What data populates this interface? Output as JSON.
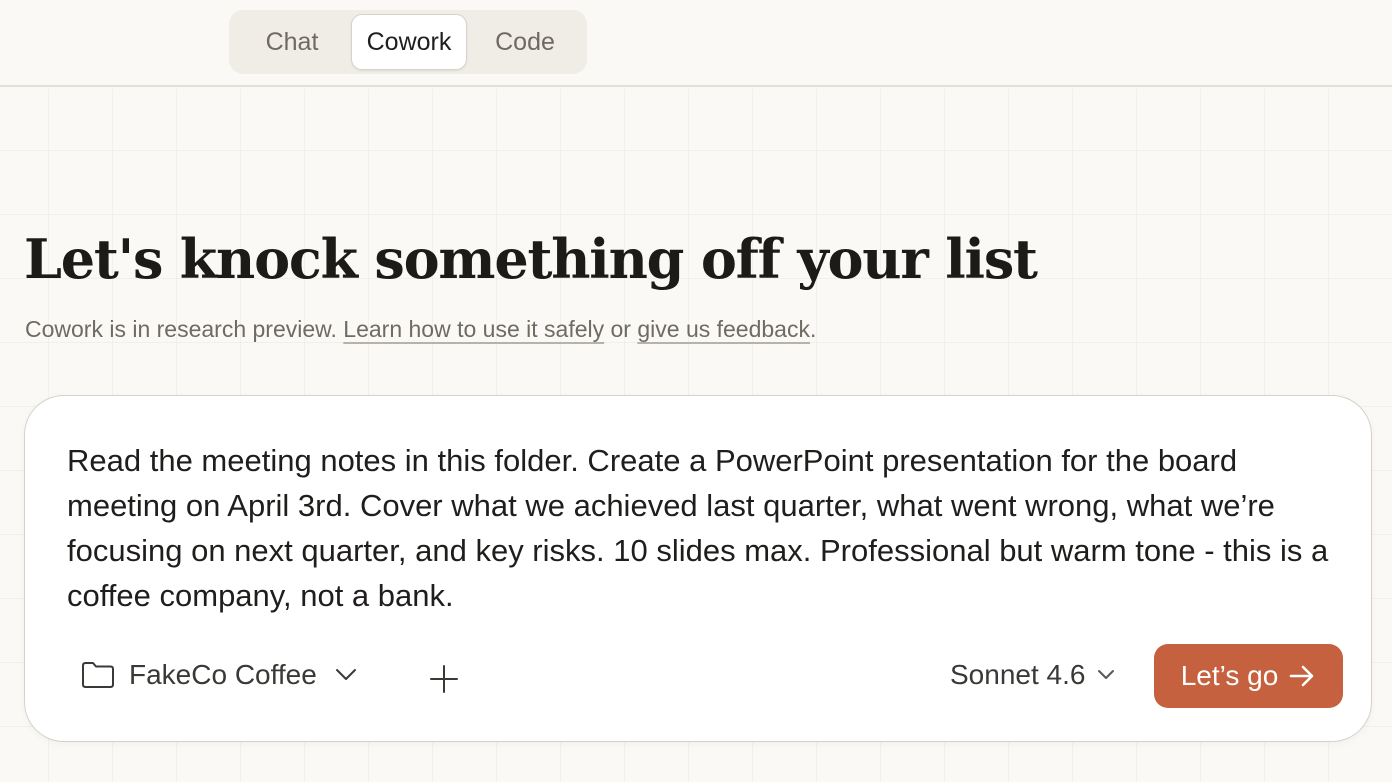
{
  "mode_switch": {
    "tabs": [
      {
        "label": "Chat",
        "active": false
      },
      {
        "label": "Cowork",
        "active": true
      },
      {
        "label": "Code",
        "active": false
      }
    ]
  },
  "hero": {
    "title": "Let's knock something off your list",
    "subtitle_prefix": "Cowork is in research preview.",
    "safety_link": "Learn how to use it safely",
    "connector": "or",
    "feedback_link": "give us feedback",
    "subtitle_suffix": "."
  },
  "composer": {
    "prompt": "Read the meeting notes in this folder. Create a PowerPoint presentation for the board meeting on April 3rd. Cover what we achieved last quarter, what went wrong, what we’re focusing on next quarter, and key risks. 10 slides max. Professional but warm tone - this is a coffee company, not a bank.",
    "folder": "FakeCo Coffee",
    "model": "Sonnet 4.6",
    "submit_label": "Let’s go"
  },
  "icons": {
    "folder": "folder-icon",
    "folder_dropdown": "chevron-down-icon",
    "add": "plus-icon",
    "model_dropdown": "chevron-down-icon",
    "submit": "arrow-right-icon"
  },
  "colors": {
    "background": "#faf9f5",
    "accent": "#c6613f",
    "text": "#1f1e1c",
    "muted_text": "#6f6b63"
  }
}
